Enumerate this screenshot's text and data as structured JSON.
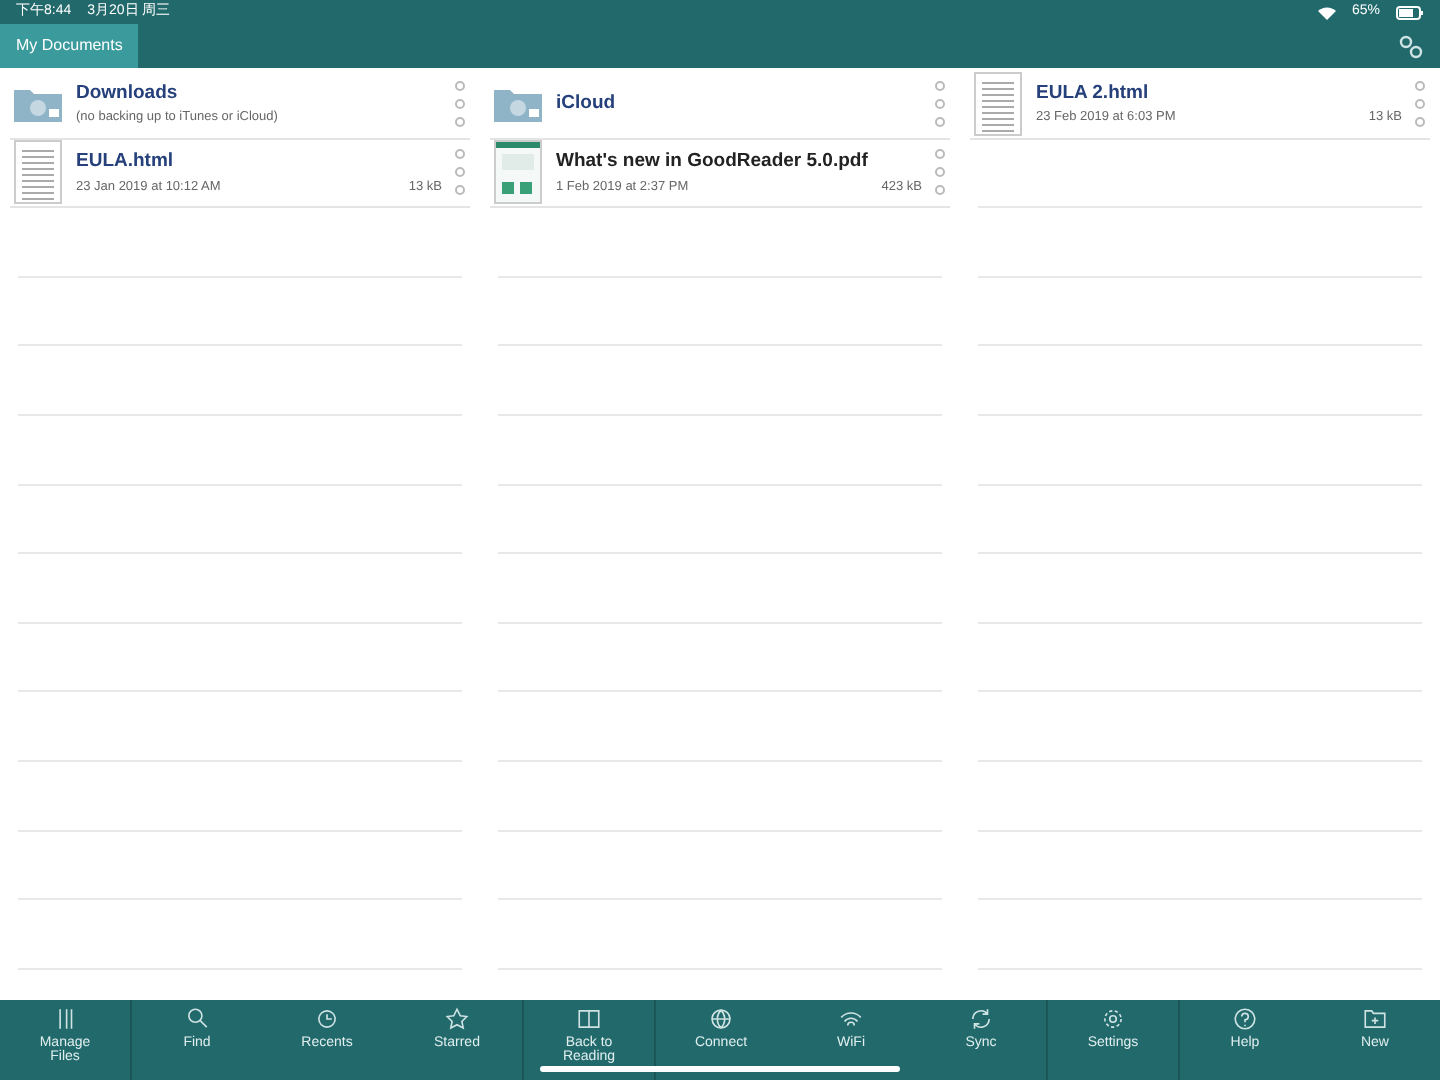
{
  "status_bar": {
    "time": "下午8:44",
    "date": "3月20日 周三",
    "battery": "65%"
  },
  "tab": {
    "label": "My Documents",
    "selected": true
  },
  "columns": [
    [
      {
        "kind": "folder",
        "name": "Downloads",
        "subtitle": "(no backing up to iTunes or iCloud)"
      },
      {
        "kind": "document",
        "name": "EULA.html",
        "subtitle": "23 Jan 2019 at 10:12 AM",
        "size": "13 kB"
      }
    ],
    [
      {
        "kind": "folder",
        "name": "iCloud"
      },
      {
        "kind": "pdf",
        "name": "What's new in GoodReader 5.0.pdf",
        "subtitle": "1 Feb 2019 at 2:37 PM",
        "size": "423 kB"
      }
    ],
    [
      {
        "kind": "document",
        "name": "EULA 2.html",
        "subtitle": "23 Feb 2019 at 6:03 PM",
        "size": "13 kB"
      }
    ]
  ],
  "toolbar": [
    {
      "label": "Manage Files"
    },
    {
      "label": "Find"
    },
    {
      "label": "Recents"
    },
    {
      "label": "Starred"
    },
    {
      "label": "Back to Reading"
    },
    {
      "label": "Connect"
    },
    {
      "label": "WiFi"
    },
    {
      "label": "Sync"
    },
    {
      "label": "Settings"
    },
    {
      "label": "Help"
    },
    {
      "label": "New"
    }
  ]
}
